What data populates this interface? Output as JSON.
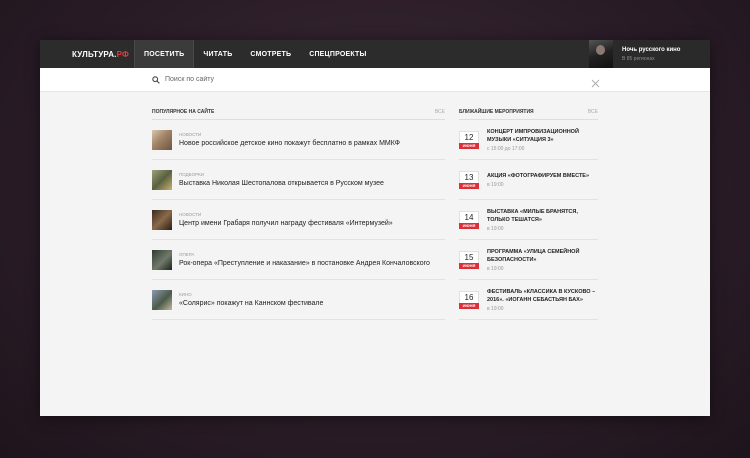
{
  "header": {
    "logo_main": "КУЛЬТУРА.",
    "logo_accent": "РФ",
    "nav": [
      {
        "label": "ПОСЕТИТЬ"
      },
      {
        "label": "ЧИТАТЬ"
      },
      {
        "label": "СМОТРЕТЬ"
      },
      {
        "label": "СПЕЦПРОЕКТЫ"
      }
    ],
    "promo": {
      "title": "Ночь русского кино",
      "subtitle": "В 85 регионах"
    }
  },
  "search": {
    "placeholder": "Поиск по сайту"
  },
  "popular": {
    "title": "ПОПУЛЯРНОЕ НА САЙТЕ",
    "all_label": "ВСЕ",
    "items": [
      {
        "category": "НОВОСТИ",
        "title": "Новое российское детское кино покажут бесплатно в рамках ММКФ"
      },
      {
        "category": "ПОДБОРКИ",
        "title": "Выставка Николая Шестопалова открывается в Русском музее"
      },
      {
        "category": "НОВОСТИ",
        "title": "Центр имени Грабаря получил награду фестиваля «Интермузей»"
      },
      {
        "category": "ОПЕРА",
        "title": "Рок-опера «Преступление и наказание» в постановке Андрея Кончаловского"
      },
      {
        "category": "КИНО",
        "title": "«Солярис» покажут на Каннском фестивале"
      }
    ]
  },
  "events": {
    "title": "БЛИЖАЙШИЕ МЕРОПРИЯТИЯ",
    "all_label": "ВСЕ",
    "items": [
      {
        "day": "12",
        "month": "ИЮНЯ",
        "title": "КОНЦЕРТ ИМПРОВИЗАЦИОННОЙ МУЗЫКИ «СИТУАЦИЯ 3»",
        "time": "с 15:00 до 17:00"
      },
      {
        "day": "13",
        "month": "ИЮНЯ",
        "title": "АКЦИЯ «ФОТОГРАФИРУЕМ ВМЕСТЕ»",
        "time": "в 19:00"
      },
      {
        "day": "14",
        "month": "ИЮНЯ",
        "title": "ВЫСТАВКА «МИЛЫЕ БРАНЯТСЯ, ТОЛЬКО ТЕШАТСЯ»",
        "time": "в 19:00"
      },
      {
        "day": "15",
        "month": "ИЮНЯ",
        "title": "ПРОГРАММА «УЛИЦА СЕМЕЙНОЙ БЕЗОПАСНОСТИ»",
        "time": "в 19:00"
      },
      {
        "day": "16",
        "month": "ИЮНЯ",
        "title": "ФЕСТИВАЛЬ «КЛАССИКА В КУСКОВО – 2016». «ИОГАНН СЕБАСТЬЯН БАХ»",
        "time": "в 19:00"
      }
    ]
  },
  "colors": {
    "accent": "#d9303a",
    "header_bg": "#2c2c2c",
    "page_bg": "#f4f4f4"
  }
}
